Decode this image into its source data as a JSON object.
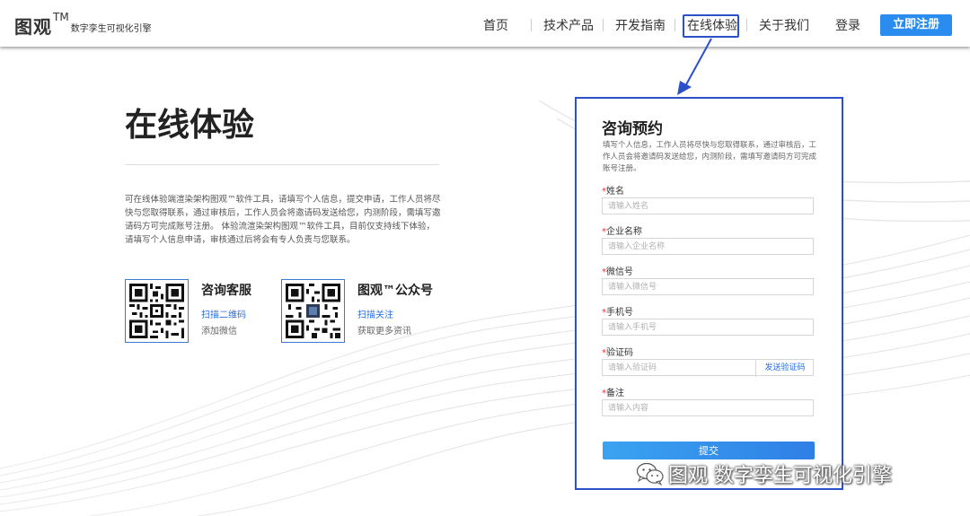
{
  "header": {
    "logo_main": "图观",
    "logo_tm": "TM",
    "logo_sub": "数字孪生可视化引擎",
    "nav": [
      "首页",
      "技术产品",
      "开发指南",
      "在线体验",
      "关于我们"
    ],
    "active_nav": "在线体验",
    "login": "登录",
    "register": "立即注册"
  },
  "main": {
    "title": "在线体验",
    "intro": "可在线体验端渲染架构图观™软件工具，请填写个人信息，提交申请，工作人员将尽快与您取得联系，通过审核后，工作人员会将邀请码发送给您，内测阶段，需填写邀请码方可完成账号注册。 体验流渲染架构图观™软件工具，目前仅支持线下体验，请填写个人信息申请，审核通过后将会有专人负责与您联系。",
    "cards": [
      {
        "title": "咨询客服",
        "link": "扫描二维码",
        "desc": "添加微信"
      },
      {
        "title": "图观™公众号",
        "link": "扫描关注",
        "desc": "获取更多资讯"
      }
    ]
  },
  "form": {
    "title": "咨询预约",
    "desc": "填写个人信息，工作人员将尽快与您取得联系，通过审核后，工作人员会将邀请码发送给您，内测阶段，需填写邀请码方可完成账号注册。",
    "fields": [
      {
        "label": "姓名",
        "placeholder": "请输入姓名",
        "value": ""
      },
      {
        "label": "企业名称",
        "placeholder": "请输入企业名称",
        "value": ""
      },
      {
        "label": "微信号",
        "placeholder": "请输入微信号",
        "value": ""
      },
      {
        "label": "手机号",
        "placeholder": "请输入手机号",
        "value": ""
      },
      {
        "label": "验证码",
        "placeholder": "请输入验证码",
        "value": ""
      },
      {
        "label": "备注",
        "placeholder": "请输入内容",
        "value": ""
      }
    ],
    "required_mark": "*",
    "send_code": "发送验证码",
    "submit": "提交"
  },
  "watermark": {
    "text": "图观 数字孪生可视化引擎",
    "icon": "wechat-icon"
  },
  "colors": {
    "accent": "#2c50c8",
    "brand_blue": "#2b8cf0",
    "link_blue": "#2b6de0",
    "required_red": "#e33333"
  }
}
